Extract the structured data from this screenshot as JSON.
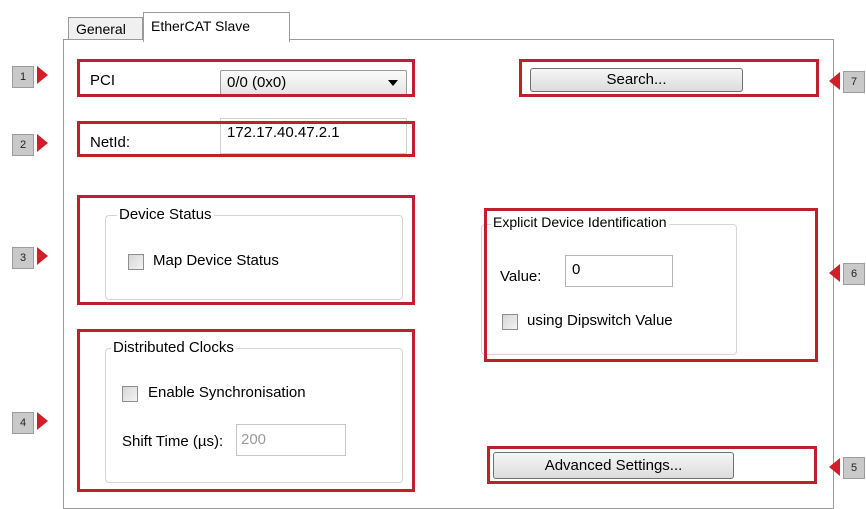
{
  "tabs": {
    "general": "General",
    "ethercat": "EtherCAT Slave"
  },
  "pci": {
    "label": "PCI",
    "value": "0/0 (0x0)"
  },
  "netid": {
    "label": "NetId:",
    "value": "172.17.40.47.2.1"
  },
  "device_status": {
    "title": "Device Status",
    "checkbox_label": "Map Device Status",
    "checked": false
  },
  "distributed_clocks": {
    "title": "Distributed Clocks",
    "checkbox_label": "Enable Synchronisation",
    "checked": false,
    "shift_label": "Shift Time (µs):",
    "shift_value": "200"
  },
  "explicit": {
    "title": "Explicit Device Identification",
    "value_label": "Value:",
    "value": "0",
    "checkbox_label": "using Dipswitch Value",
    "checked": false
  },
  "buttons": {
    "search": "Search...",
    "advanced": "Advanced Settings..."
  },
  "callouts": [
    "1",
    "2",
    "3",
    "4",
    "5",
    "6",
    "7"
  ],
  "colors": {
    "highlight": "#c0202b",
    "arrow": "#d01e2a",
    "marker_bg": "#c9c9c9"
  }
}
